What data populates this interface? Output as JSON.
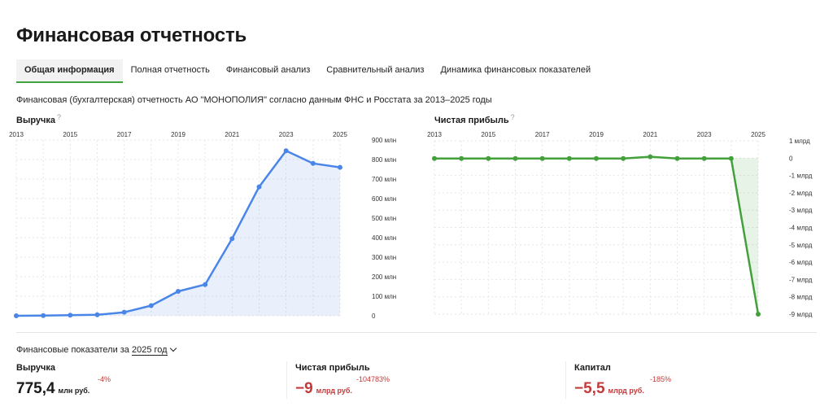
{
  "page": {
    "title": "Финансовая отчетность"
  },
  "tabs": [
    {
      "label": "Общая информация",
      "active": true
    },
    {
      "label": "Полная отчетность",
      "active": false
    },
    {
      "label": "Финансовый анализ",
      "active": false
    },
    {
      "label": "Сравнительный анализ",
      "active": false
    },
    {
      "label": "Динамика финансовых показателей",
      "active": false
    }
  ],
  "subtitle": "Финансовая (бухгалтерская) отчетность АО \"МОНОПОЛИЯ\" согласно данным ФНС и Росстата за 2013–2025 годы",
  "help_mark": "?",
  "colors": {
    "revenue": "#4a86e8",
    "profit": "#43a03b",
    "negative": "#c43a3a",
    "tab_accent": "#3fa33f"
  },
  "chart_data": [
    {
      "type": "area",
      "title": "Выручка",
      "x_tick_labels": [
        "2013",
        "2015",
        "2017",
        "2019",
        "2021",
        "2023",
        "2025"
      ],
      "y_tick_labels": [
        "900 млн",
        "800 млн",
        "700 млн",
        "600 млн",
        "500 млн",
        "400 млн",
        "300 млн",
        "200 млн",
        "100 млн",
        "0"
      ],
      "ylim": [
        0,
        900
      ],
      "y_unit": "млн",
      "x": [
        2013,
        2014,
        2015,
        2016,
        2017,
        2018,
        2019,
        2020,
        2021,
        2022,
        2023,
        2024,
        2025
      ],
      "values": [
        0,
        1,
        3,
        5,
        18,
        52,
        125,
        160,
        395,
        660,
        845,
        780,
        760
      ],
      "grid": true,
      "y_axis_side": "right"
    },
    {
      "type": "area",
      "title": "Чистая прибыль",
      "x_tick_labels": [
        "2013",
        "2015",
        "2017",
        "2019",
        "2021",
        "2023",
        "2025"
      ],
      "y_tick_labels": [
        "1 млрд",
        "0",
        "-1 млрд",
        "-2 млрд",
        "-3 млрд",
        "-4 млрд",
        "-5 млрд",
        "-6 млрд",
        "-7 млрд",
        "-8 млрд",
        "-9 млрд"
      ],
      "ylim": [
        -9,
        1
      ],
      "y_unit": "млрд",
      "x": [
        2013,
        2014,
        2015,
        2016,
        2017,
        2018,
        2019,
        2020,
        2021,
        2022,
        2023,
        2024,
        2025
      ],
      "values": [
        -0.02,
        -0.02,
        -0.02,
        -0.02,
        -0.02,
        -0.02,
        -0.02,
        -0.02,
        0.08,
        -0.02,
        -0.02,
        -0.02,
        -9.0
      ],
      "grid": true,
      "y_axis_side": "right"
    }
  ],
  "period": {
    "label": "Финансовые показатели за",
    "year": "2025 год"
  },
  "metrics": [
    {
      "label": "Выручка",
      "value": "775,4",
      "unit": "млн руб.",
      "change": "-4%"
    },
    {
      "label": "Чистая прибыль",
      "value": "−9",
      "unit": "млрд руб.",
      "change": "-104783%"
    },
    {
      "label": "Капитал",
      "value": "−5,5",
      "unit": "млрд руб.",
      "change": "-185%"
    }
  ]
}
